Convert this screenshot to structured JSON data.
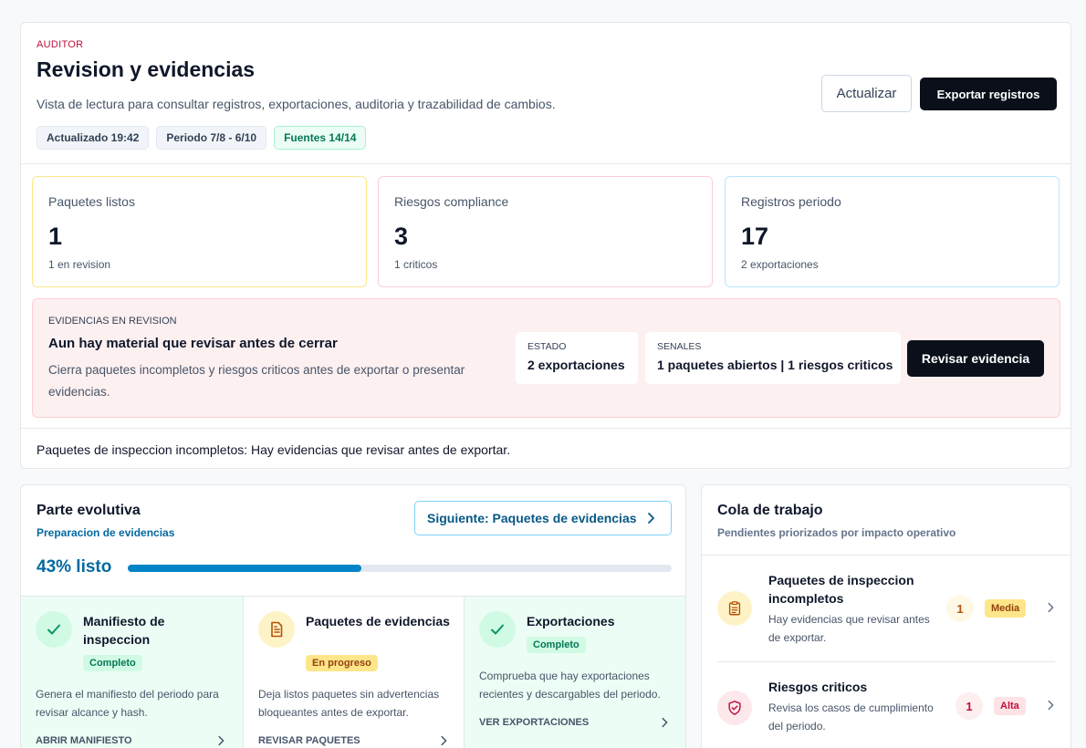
{
  "header": {
    "eyebrow": "AUDITOR",
    "title": "Revision y evidencias",
    "subtitle": "Vista de lectura para consultar registros, exportaciones, auditoria y trazabilidad de cambios.",
    "chips": [
      "Actualizado 19:42",
      "Periodo 7/8 - 6/10",
      "Fuentes 14/14"
    ],
    "refresh_label": "Actualizar",
    "export_label": "Exportar registros"
  },
  "stats": [
    {
      "label": "Paquetes listos",
      "value": "1",
      "sub": "1 en revision",
      "color": "#fde68a"
    },
    {
      "label": "Riesgos compliance",
      "value": "3",
      "sub": "1 criticos",
      "color": "#fbcfd5"
    },
    {
      "label": "Registros periodo",
      "value": "17",
      "sub": "2 exportaciones",
      "color": "#bae6fd"
    }
  ],
  "alert": {
    "eyebrow": "EVIDENCIAS EN REVISION",
    "title": "Aun hay material que revisar antes de cerrar",
    "text": "Cierra paquetes incompletos y riesgos criticos antes de exportar o presentar evidencias.",
    "estado_label": "ESTADO",
    "estado_value": "2 exportaciones",
    "senales_label": "SENALES",
    "senales_value": "1 paquetes abiertos | 1 riesgos criticos",
    "button": "Revisar evidencia"
  },
  "footline": "Paquetes de inspeccion incompletos: Hay evidencias que revisar antes de exportar.",
  "evolutiva": {
    "title": "Parte evolutiva",
    "subtitle": "Preparacion de evidencias",
    "next_label": "Siguiente: Paquetes de evidencias",
    "progress_label": "43% listo",
    "progress": 0.43,
    "steps": [
      {
        "title": "Manifiesto de inspeccion",
        "status": "Completo",
        "text": "Genera el manifiesto del periodo para revisar alcance y hash.",
        "link": "ABRIR MANIFIESTO"
      },
      {
        "title": "Paquetes de evidencias",
        "status": "En progreso",
        "text": "Deja listos paquetes sin advertencias bloqueantes antes de exportar.",
        "link": "REVISAR PAQUETES"
      },
      {
        "title": "Exportaciones",
        "status": "Completo",
        "text": "Comprueba que hay exportaciones recientes y descargables del periodo.",
        "link": "VER EXPORTACIONES"
      }
    ]
  },
  "queue": {
    "title": "Cola de trabajo",
    "subtitle": "Pendientes priorizados por impacto operativo",
    "items": [
      {
        "name": "Paquetes de inspeccion incompletos",
        "desc": "Hay evidencias que revisar antes de exportar.",
        "count": "1",
        "priority": "Media",
        "icon": "clipboard-icon"
      },
      {
        "name": "Riesgos criticos",
        "desc": "Revisa los casos de cumplimiento del periodo.",
        "count": "1",
        "priority": "Alta",
        "icon": "shield-check-icon"
      }
    ]
  }
}
